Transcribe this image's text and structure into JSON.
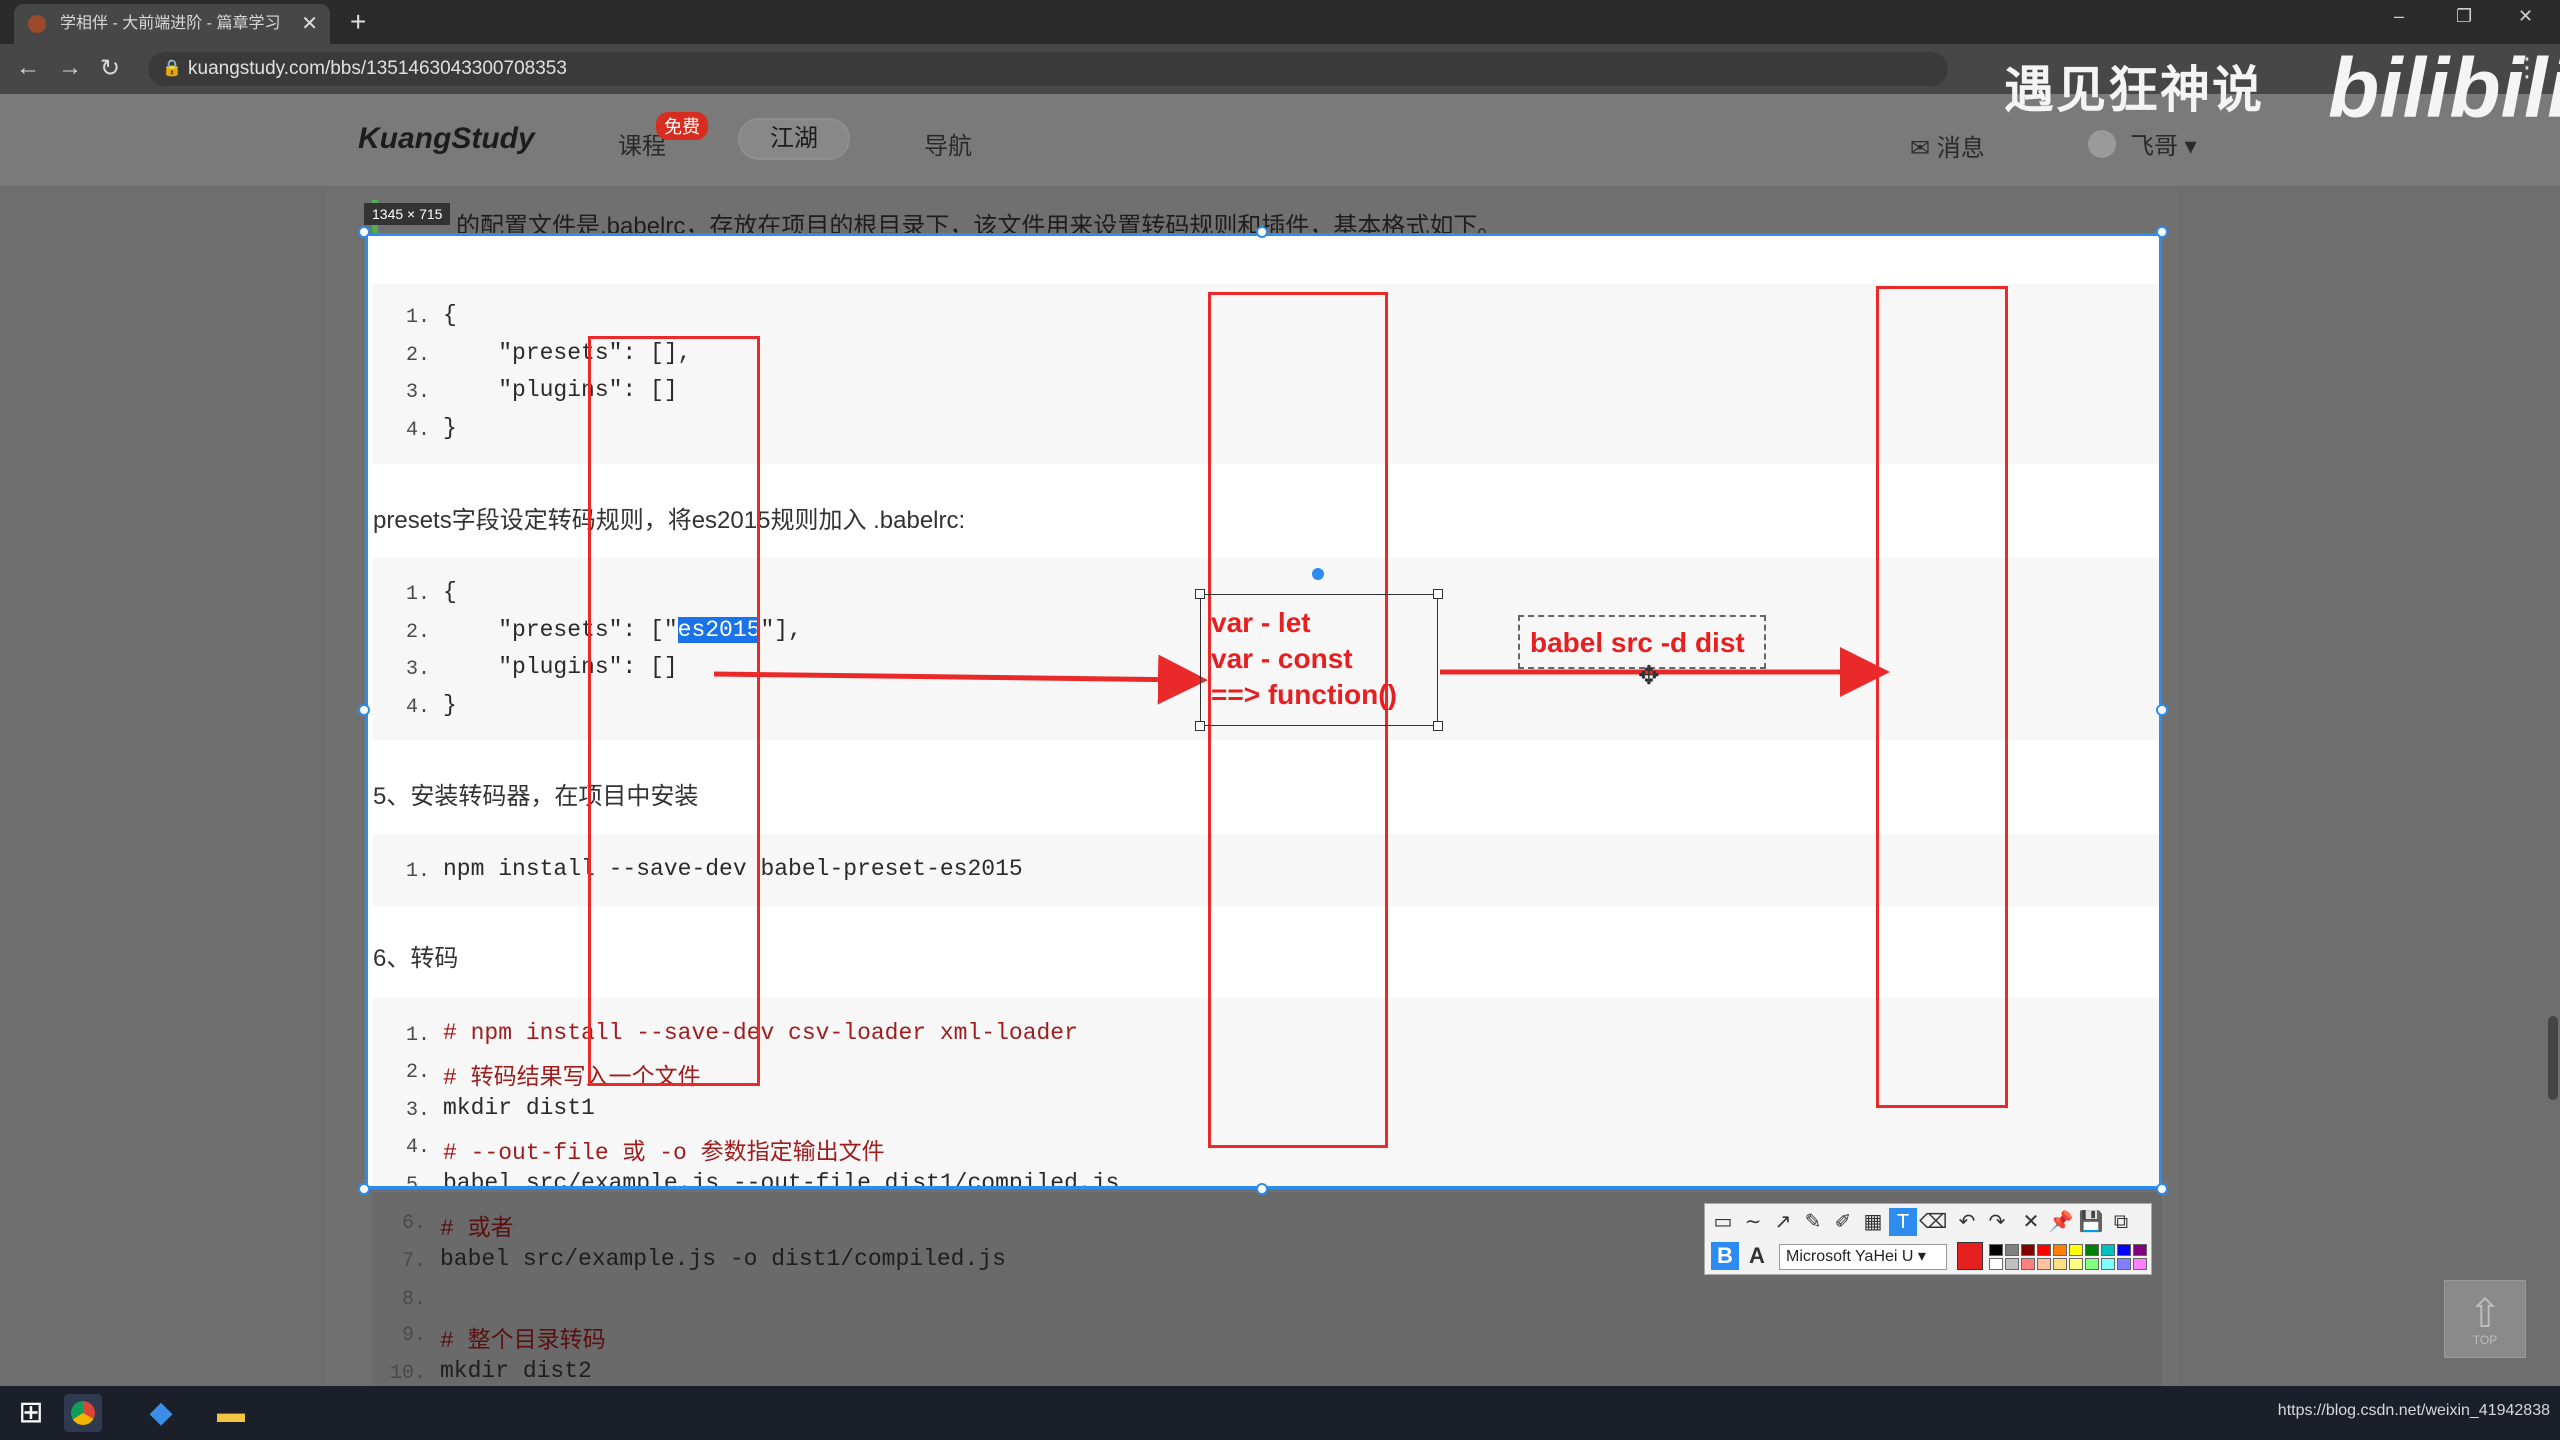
{
  "browser": {
    "tab_title": "学相伴 - 大前端进阶 - 篇章学习",
    "tab_close": "✕",
    "new_tab": "+",
    "url": "kuangstudy.com/bbs/1351463043300708353",
    "window_controls": [
      "–",
      "❐",
      "✕"
    ]
  },
  "site": {
    "logo": "KuangStudy",
    "nav": {
      "course": "课程",
      "course_badge": "免费",
      "jianghu": "江湖",
      "guide": "导航"
    },
    "messages": "消息",
    "user": "飞哥 ▾",
    "watermark": "遇见狂神说",
    "watermark_brand": "bilibili"
  },
  "capture": {
    "size_label": "1345 × 715"
  },
  "content": {
    "intro": "的配置文件是.babelrc，存放在项目的根目录下，该文件用来设置转码规则和插件，基本格式如下。",
    "code1": [
      {
        "n": "1.",
        "text": "{"
      },
      {
        "n": "2.",
        "text": "    \"presets\": [],"
      },
      {
        "n": "3.",
        "text": "    \"plugins\": []"
      },
      {
        "n": "4.",
        "text": "}"
      }
    ],
    "presets_note": "presets字段设定转码规则，将es2015规则加入 .babelrc:",
    "code2": {
      "line1": {
        "n": "1.",
        "text": "{"
      },
      "line2_pre": "    \"presets\": [\"",
      "line2_hl": "es2015",
      "line2_post": "\"],",
      "line2_n": "2.",
      "line3": {
        "n": "3.",
        "text": "    \"plugins\": []"
      },
      "line4": {
        "n": "4.",
        "text": "}"
      }
    },
    "step5": "5、安装转码器，在项目中安装",
    "code3": {
      "n": "1.",
      "text": "npm install --save-dev babel-preset-es2015"
    },
    "step6": "6、转码",
    "code4": [
      {
        "n": "1.",
        "text": "# npm install --save-dev csv-loader xml-loader",
        "type": "comment"
      },
      {
        "n": "2.",
        "text": "# 转码结果写入一个文件",
        "type": "comment"
      },
      {
        "n": "3.",
        "text": "mkdir dist1",
        "type": "code"
      },
      {
        "n": "4.",
        "text": "# --out-file 或 -o 参数指定输出文件",
        "type": "comment"
      },
      {
        "n": "5.",
        "text": "babel src/example.js --out-file dist1/compiled.js",
        "type": "code"
      },
      {
        "n": "6.",
        "text": "# 或者",
        "type": "comment"
      },
      {
        "n": "7.",
        "text": "babel src/example.js -o dist1/compiled.js",
        "type": "code"
      },
      {
        "n": "8.",
        "text": "",
        "type": "code"
      },
      {
        "n": "9.",
        "text": "# 整个目录转码",
        "type": "comment"
      },
      {
        "n": "10.",
        "text": "mkdir dist2",
        "type": "code"
      }
    ]
  },
  "annotations": {
    "textbox_lines": [
      "var - let",
      "var - const",
      "==> function()"
    ],
    "dashed_text": "babel src -d dist",
    "color": "#e62020"
  },
  "toolbar": {
    "tools": [
      "rect-icon",
      "curve-icon",
      "arrow-icon",
      "pen-icon",
      "marker-icon",
      "mosaic-icon",
      "text-icon",
      "eraser-icon",
      "undo-icon",
      "redo-icon",
      "close-icon",
      "pin-icon",
      "save-icon",
      "copy-icon"
    ],
    "tool_glyphs": [
      "▭",
      "∼",
      "↗",
      "✎",
      "✐",
      "▦",
      "T",
      "⌫",
      "↶",
      "↷",
      "✕",
      "📌",
      "💾",
      "⧉"
    ],
    "bold": "B",
    "font_a": "A",
    "font_name": "Microsoft YaHei U ▾",
    "palette": [
      "#000000",
      "#808080",
      "#800000",
      "#ff0000",
      "#ff8000",
      "#ffff00",
      "#008000",
      "#00c0c0",
      "#0000ff",
      "#800080",
      "#ffffff",
      "#c0c0c0",
      "#ff8080",
      "#ffc0a0",
      "#ffe080",
      "#ffff80",
      "#80ff80",
      "#80ffff",
      "#8080ff",
      "#ff80ff"
    ]
  },
  "scroll_top": {
    "arrow": "⇧",
    "label": "TOP"
  },
  "taskbar": {
    "tray_url": "https://blog.csdn.net/weixin_41942838"
  }
}
